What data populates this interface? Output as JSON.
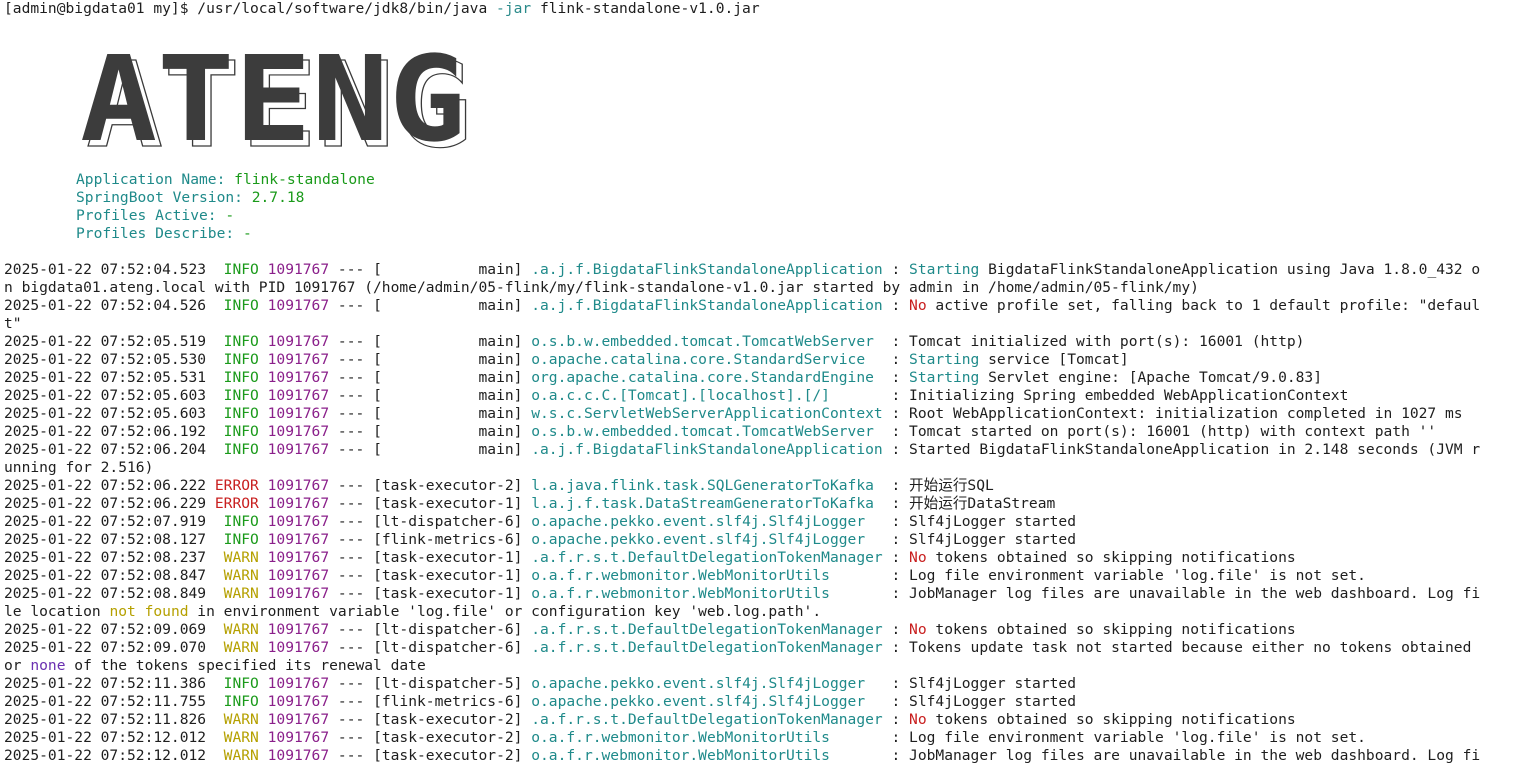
{
  "prompt": {
    "text": "[admin@bigdata01 my]$ /usr/local/software/jdk8/bin/java ",
    "flag": "-jar",
    "arg": " flink-standalone-v1.0.jar"
  },
  "banner": {
    "text": "ATENG"
  },
  "app_info": {
    "name_label": "Application Name: ",
    "name_value": "flink-standalone",
    "version_label": "SpringBoot Version: ",
    "version_value": "2.7.18",
    "profiles_active_label": "Profiles Active: ",
    "profiles_active_value": "-",
    "profiles_describe_label": "Profiles Describe: ",
    "profiles_describe_value": "-"
  },
  "log_lines": [
    {
      "ts": "2025-01-22 07:52:04.523",
      "level": "INFO",
      "lvl_class": "c-info",
      "pid": "1091767",
      "thread": " --- [           main] ",
      "logger": ".a.j.f.BigdataFlinkStandaloneApplication",
      "sep": " : ",
      "hl": "Starting",
      "hl_class": "w-start",
      "msg": " BigdataFlinkStandaloneApplication using Java 1.8.0_432 o"
    },
    {
      "cont": "n bigdata01.ateng.local with PID 1091767 (/home/admin/05-flink/my/flink-standalone-v1.0.jar started by admin in /home/admin/05-flink/my)"
    },
    {
      "ts": "2025-01-22 07:52:04.526",
      "level": "INFO",
      "lvl_class": "c-info",
      "pid": "1091767",
      "thread": " --- [           main] ",
      "logger": ".a.j.f.BigdataFlinkStandaloneApplication",
      "sep": " : ",
      "hl": "No",
      "hl_class": "w-no",
      "msg": " active profile set, falling back to 1 default profile: \"defaul"
    },
    {
      "cont": "t\""
    },
    {
      "ts": "2025-01-22 07:52:05.519",
      "level": "INFO",
      "lvl_class": "c-info",
      "pid": "1091767",
      "thread": " --- [           main] ",
      "logger": "o.s.b.w.embedded.tomcat.TomcatWebServer ",
      "sep": " : ",
      "hl": "",
      "hl_class": "",
      "msg": "Tomcat initialized with port(s): 16001 (http)"
    },
    {
      "ts": "2025-01-22 07:52:05.530",
      "level": "INFO",
      "lvl_class": "c-info",
      "pid": "1091767",
      "thread": " --- [           main] ",
      "logger": "o.apache.catalina.core.StandardService  ",
      "sep": " : ",
      "hl": "Starting",
      "hl_class": "w-start",
      "msg": " service [Tomcat]"
    },
    {
      "ts": "2025-01-22 07:52:05.531",
      "level": "INFO",
      "lvl_class": "c-info",
      "pid": "1091767",
      "thread": " --- [           main] ",
      "logger": "org.apache.catalina.core.StandardEngine ",
      "sep": " : ",
      "hl": "Starting",
      "hl_class": "w-start",
      "msg": " Servlet engine: [Apache Tomcat/9.0.83]"
    },
    {
      "ts": "2025-01-22 07:52:05.603",
      "level": "INFO",
      "lvl_class": "c-info",
      "pid": "1091767",
      "thread": " --- [           main] ",
      "logger": "o.a.c.c.C.[Tomcat].[localhost].[/]      ",
      "sep": " : ",
      "hl": "",
      "hl_class": "",
      "msg": "Initializing Spring embedded WebApplicationContext"
    },
    {
      "ts": "2025-01-22 07:52:05.603",
      "level": "INFO",
      "lvl_class": "c-info",
      "pid": "1091767",
      "thread": " --- [           main] ",
      "logger": "w.s.c.ServletWebServerApplicationContext",
      "sep": " : ",
      "hl": "",
      "hl_class": "",
      "msg": "Root WebApplicationContext: initialization completed in 1027 ms"
    },
    {
      "ts": "2025-01-22 07:52:06.192",
      "level": "INFO",
      "lvl_class": "c-info",
      "pid": "1091767",
      "thread": " --- [           main] ",
      "logger": "o.s.b.w.embedded.tomcat.TomcatWebServer ",
      "sep": " : ",
      "hl": "",
      "hl_class": "",
      "msg": "Tomcat started on port(s): 16001 (http) with context path ''"
    },
    {
      "ts": "2025-01-22 07:52:06.204",
      "level": "INFO",
      "lvl_class": "c-info",
      "pid": "1091767",
      "thread": " --- [           main] ",
      "logger": ".a.j.f.BigdataFlinkStandaloneApplication",
      "sep": " : ",
      "hl": "",
      "hl_class": "",
      "msg": "Started BigdataFlinkStandaloneApplication in 2.148 seconds (JVM r"
    },
    {
      "cont": "unning for 2.516)"
    },
    {
      "ts": "2025-01-22 07:52:06.222",
      "level": "ERROR",
      "lvl_class": "c-error",
      "pid": "1091767",
      "thread": " --- [task-executor-2] ",
      "logger": "l.a.java.flink.task.SQLGeneratorToKafka ",
      "sep": " : ",
      "hl": "",
      "hl_class": "",
      "msg": "开始运行SQL"
    },
    {
      "ts": "2025-01-22 07:52:06.229",
      "level": "ERROR",
      "lvl_class": "c-error",
      "pid": "1091767",
      "thread": " --- [task-executor-1] ",
      "logger": "l.a.j.f.task.DataStreamGeneratorToKafka ",
      "sep": " : ",
      "hl": "",
      "hl_class": "",
      "msg": "开始运行DataStream"
    },
    {
      "ts": "2025-01-22 07:52:07.919",
      "level": "INFO",
      "lvl_class": "c-info",
      "pid": "1091767",
      "thread": " --- [lt-dispatcher-6] ",
      "logger": "o.apache.pekko.event.slf4j.Slf4jLogger  ",
      "sep": " : ",
      "hl": "",
      "hl_class": "",
      "msg": "Slf4jLogger started"
    },
    {
      "ts": "2025-01-22 07:52:08.127",
      "level": "INFO",
      "lvl_class": "c-info",
      "pid": "1091767",
      "thread": " --- [flink-metrics-6] ",
      "logger": "o.apache.pekko.event.slf4j.Slf4jLogger  ",
      "sep": " : ",
      "hl": "",
      "hl_class": "",
      "msg": "Slf4jLogger started"
    },
    {
      "ts": "2025-01-22 07:52:08.237",
      "level": "WARN",
      "lvl_class": "c-warn",
      "pid": "1091767",
      "thread": " --- [task-executor-1] ",
      "logger": ".a.f.r.s.t.DefaultDelegationTokenManager",
      "sep": " : ",
      "hl": "No",
      "hl_class": "w-no",
      "msg": " tokens obtained so skipping notifications"
    },
    {
      "ts": "2025-01-22 07:52:08.847",
      "level": "WARN",
      "lvl_class": "c-warn",
      "pid": "1091767",
      "thread": " --- [task-executor-1] ",
      "logger": "o.a.f.r.webmonitor.WebMonitorUtils      ",
      "sep": " : ",
      "hl": "",
      "hl_class": "",
      "msg": "Log file environment variable 'log.file' is not set."
    },
    {
      "ts": "2025-01-22 07:52:08.849",
      "level": "WARN",
      "lvl_class": "c-warn",
      "pid": "1091767",
      "thread": " --- [task-executor-1] ",
      "logger": "o.a.f.r.webmonitor.WebMonitorUtils      ",
      "sep": " : ",
      "hl": "",
      "hl_class": "",
      "msg": "JobManager log files are unavailable in the web dashboard. Log fi"
    },
    {
      "cont_a": "le location ",
      "cont_hl": "not found",
      "cont_hl_class": "w-notfound",
      "cont_b": " in environment variable 'log.file' or configuration key 'web.log.path'."
    },
    {
      "ts": "2025-01-22 07:52:09.069",
      "level": "WARN",
      "lvl_class": "c-warn",
      "pid": "1091767",
      "thread": " --- [lt-dispatcher-6] ",
      "logger": ".a.f.r.s.t.DefaultDelegationTokenManager",
      "sep": " : ",
      "hl": "No",
      "hl_class": "w-no",
      "msg": " tokens obtained so skipping notifications"
    },
    {
      "ts": "2025-01-22 07:52:09.070",
      "level": "WARN",
      "lvl_class": "c-warn",
      "pid": "1091767",
      "thread": " --- [lt-dispatcher-6] ",
      "logger": ".a.f.r.s.t.DefaultDelegationTokenManager",
      "sep": " : ",
      "hl": "",
      "hl_class": "",
      "msg": "Tokens update task not started because either no tokens obtained"
    },
    {
      "cont_a": "or ",
      "cont_hl": "none",
      "cont_hl_class": "w-none",
      "cont_b": " of the tokens specified its renewal date"
    },
    {
      "ts": "2025-01-22 07:52:11.386",
      "level": "INFO",
      "lvl_class": "c-info",
      "pid": "1091767",
      "thread": " --- [lt-dispatcher-5] ",
      "logger": "o.apache.pekko.event.slf4j.Slf4jLogger  ",
      "sep": " : ",
      "hl": "",
      "hl_class": "",
      "msg": "Slf4jLogger started"
    },
    {
      "ts": "2025-01-22 07:52:11.755",
      "level": "INFO",
      "lvl_class": "c-info",
      "pid": "1091767",
      "thread": " --- [flink-metrics-6] ",
      "logger": "o.apache.pekko.event.slf4j.Slf4jLogger  ",
      "sep": " : ",
      "hl": "",
      "hl_class": "",
      "msg": "Slf4jLogger started"
    },
    {
      "ts": "2025-01-22 07:52:11.826",
      "level": "WARN",
      "lvl_class": "c-warn",
      "pid": "1091767",
      "thread": " --- [task-executor-2] ",
      "logger": ".a.f.r.s.t.DefaultDelegationTokenManager",
      "sep": " : ",
      "hl": "No",
      "hl_class": "w-no",
      "msg": " tokens obtained so skipping notifications"
    },
    {
      "ts": "2025-01-22 07:52:12.012",
      "level": "WARN",
      "lvl_class": "c-warn",
      "pid": "1091767",
      "thread": " --- [task-executor-2] ",
      "logger": "o.a.f.r.webmonitor.WebMonitorUtils      ",
      "sep": " : ",
      "hl": "",
      "hl_class": "",
      "msg": "Log file environment variable 'log.file' is not set."
    },
    {
      "ts": "2025-01-22 07:52:12.012",
      "level": "WARN",
      "lvl_class": "c-warn",
      "pid": "1091767",
      "thread": " --- [task-executor-2] ",
      "logger": "o.a.f.r.webmonitor.WebMonitorUtils      ",
      "sep": " : ",
      "hl": "",
      "hl_class": "",
      "msg": "JobManager log files are unavailable in the web dashboard. Log fi"
    }
  ]
}
